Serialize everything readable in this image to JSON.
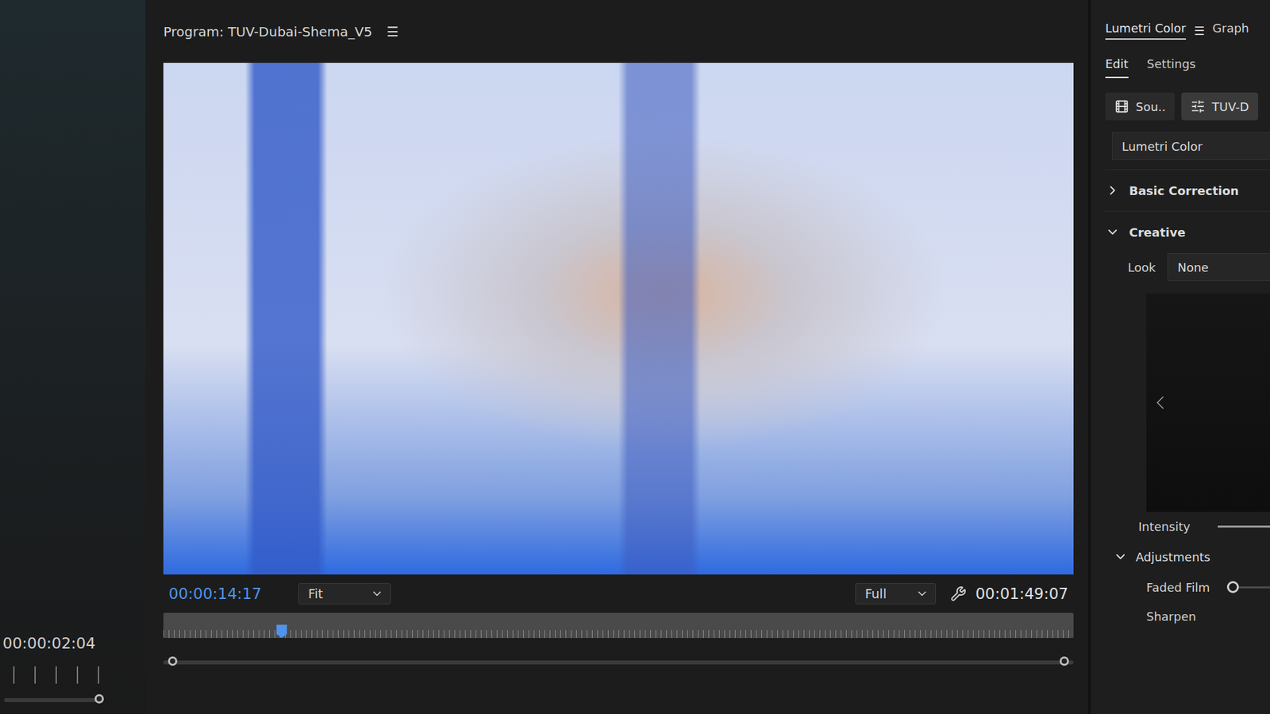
{
  "left_panel": {
    "timecode": "00:00:02:04",
    "zoom_level": 1
  },
  "program_monitor": {
    "title": "Program: TUV-Dubai-Shema_V5",
    "menu": "☰",
    "current_time": "00:00:14:17",
    "zoom": "Fit",
    "resolution": "Full",
    "duration": "00:01:49:07",
    "playhead_level": 0.13
  },
  "lumetri": {
    "panel_tabs": [
      {
        "label": "Lumetri Color",
        "selected": true
      },
      {
        "label": "Graph",
        "selected": false
      }
    ],
    "menu": "☰",
    "tabs": [
      {
        "label": "Edit",
        "selected": true
      },
      {
        "label": "Settings",
        "selected": false
      }
    ],
    "clip_buttons": [
      {
        "label": "Sou..",
        "selected": false
      },
      {
        "label": "TUV-D",
        "selected": true
      }
    ],
    "effect": "Lumetri Color",
    "sections": [
      {
        "label": "Basic Correction",
        "expanded": false
      },
      {
        "label": "Creative",
        "expanded": true
      }
    ],
    "look": {
      "label": "Look",
      "value": "None"
    },
    "intensity": {
      "label": "Intensity",
      "level": 1
    },
    "adjustments": {
      "label": "Adjustments",
      "expanded": true
    },
    "adjustment_items": [
      {
        "label": "Faded Film",
        "kind": "slider",
        "level": 0
      },
      {
        "label": "Sharpen",
        "kind": "label"
      }
    ]
  }
}
